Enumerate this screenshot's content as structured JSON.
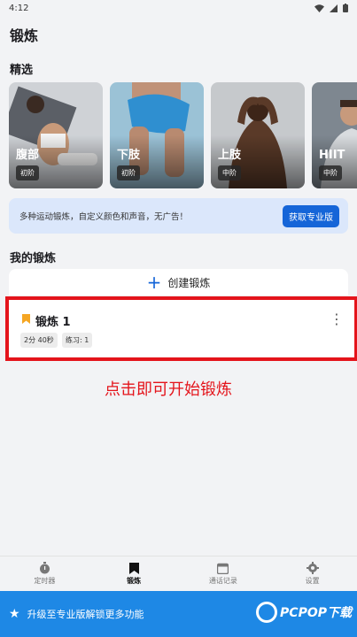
{
  "status": {
    "time": "4:12"
  },
  "appbar": {
    "title": "锻炼"
  },
  "featured": {
    "title": "精选",
    "cards": [
      {
        "name": "腹部",
        "level": "初阶"
      },
      {
        "name": "下肢",
        "level": "初阶"
      },
      {
        "name": "上肢",
        "level": "中阶"
      },
      {
        "name": "HIIT",
        "level": "中阶"
      }
    ]
  },
  "promo": {
    "text": "多种运动锻炼，自定义颜色和声音，无广告！",
    "button": "获取专业版"
  },
  "my_workouts": {
    "title": "我的锻炼",
    "create_label": "创建锻炼",
    "items": [
      {
        "title": "锻炼 1",
        "duration": "2分 40秒",
        "exercises": "练习: 1"
      }
    ]
  },
  "annotation": {
    "tip": "点击即可开始锻炼"
  },
  "nav": {
    "items": [
      {
        "label": "定时器",
        "icon": "stopwatch-icon"
      },
      {
        "label": "锻炼",
        "icon": "bookmark-icon"
      },
      {
        "label": "通话记录",
        "icon": "calendar-icon"
      },
      {
        "label": "设置",
        "icon": "gear-icon"
      }
    ]
  },
  "upgrade": {
    "text": "升级至专业版解锁更多功能",
    "icon": "star-icon"
  },
  "watermark": {
    "text": "PCPOP下载"
  },
  "colors": {
    "accent": "#1565d8",
    "highlight": "#e4141b",
    "banner": "#1e88e5",
    "flag": "#f5a623"
  }
}
